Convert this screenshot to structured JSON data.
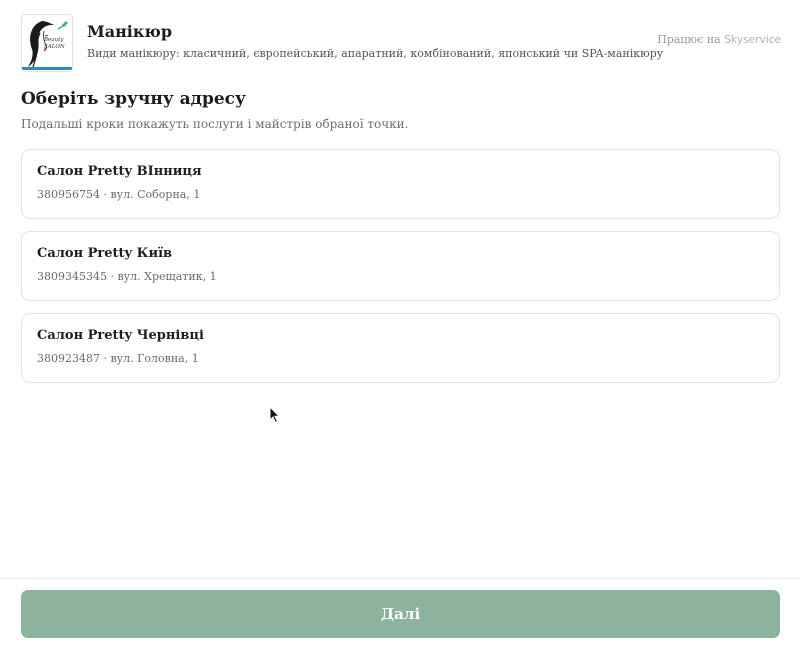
{
  "header": {
    "business_name": "Манікюр",
    "business_description": "Види манікюру: класичний, європейський, апаратний, комбінований, японський чи SPA-манікюру",
    "powered_by_label": "Працює на",
    "powered_by_brand": "Skyservice",
    "logo_text": "Beauty SALON"
  },
  "main": {
    "title": "Оберіть зручну адресу",
    "subtitle": "Подальші кроки покажуть послуги і майстрів обраної точки.",
    "locations": [
      {
        "name": "Салон Pretty ВІнниця",
        "phone": "380956754",
        "address": "вул. Соборна, 1",
        "info": "380956754 · вул. Соборна, 1"
      },
      {
        "name": "Салон Pretty Київ",
        "phone": "3809345345",
        "address": "вул. Хрещатик, 1",
        "info": "3809345345 · вул. Хрещатик, 1"
      },
      {
        "name": "Салон Pretty Чернівці",
        "phone": "380923487",
        "address": "вул. Головна, 1",
        "info": "380923487 · вул. Головна, 1"
      }
    ]
  },
  "footer": {
    "next_label": "Далі",
    "next_color": "#8db39f"
  },
  "icons": {
    "logo": "beauty-salon-logo",
    "cursor": "mouse-pointer-icon"
  }
}
